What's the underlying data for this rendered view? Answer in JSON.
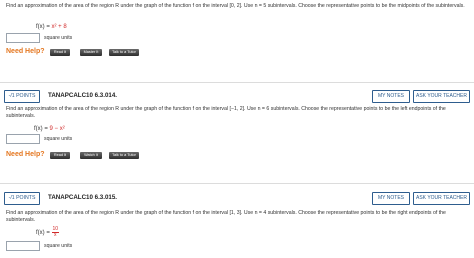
{
  "q1": {
    "problem": "Find an approximation of the area of the region R under the graph of the function f on the interval [0, 2]. Use n = 5 subintervals. Choose the representative points to be the midpoints of the subintervals.",
    "f_lhs": "f(x) = ",
    "f_rhs": "x² + 8",
    "answer": "",
    "units": "square units",
    "need_help": "Need Help?",
    "buttons": [
      "Read It",
      "Master It",
      "Talk to a Tutor"
    ]
  },
  "q2": {
    "points": "-/1 POINTS",
    "id": "TANAPCALC10 6.3.014.",
    "my_notes": "MY NOTES",
    "ask_teacher": "ASK YOUR TEACHER",
    "problem": "Find an approximation of the area of the region R under the graph of the function f on the interval [−1, 2]. Use n = 6 subintervals. Choose the representative points to be the left endpoints of the subintervals.",
    "f_lhs": "f(x) = ",
    "f_rhs": "9 − x²",
    "answer": "",
    "units": "square units",
    "need_help": "Need Help?",
    "buttons": [
      "Read It",
      "Watch It",
      "Talk to a Tutor"
    ]
  },
  "q3": {
    "points": "-/1 POINTS",
    "id": "TANAPCALC10 6.3.015.",
    "my_notes": "MY NOTES",
    "ask_teacher": "ASK YOUR TEACHER",
    "problem": "Find an approximation of the area of the region R under the graph of the function f on the interval [1, 3]. Use n = 4 subintervals. Choose the representative points to be the right endpoints of the subintervals.",
    "f_lhs": "f(x) = ",
    "f_num": "10",
    "f_den": "x",
    "answer": "",
    "units": "square units"
  },
  "colors": {
    "accent": "#2e5d8e",
    "help": "#e4761f",
    "func": "#d12a2a"
  }
}
